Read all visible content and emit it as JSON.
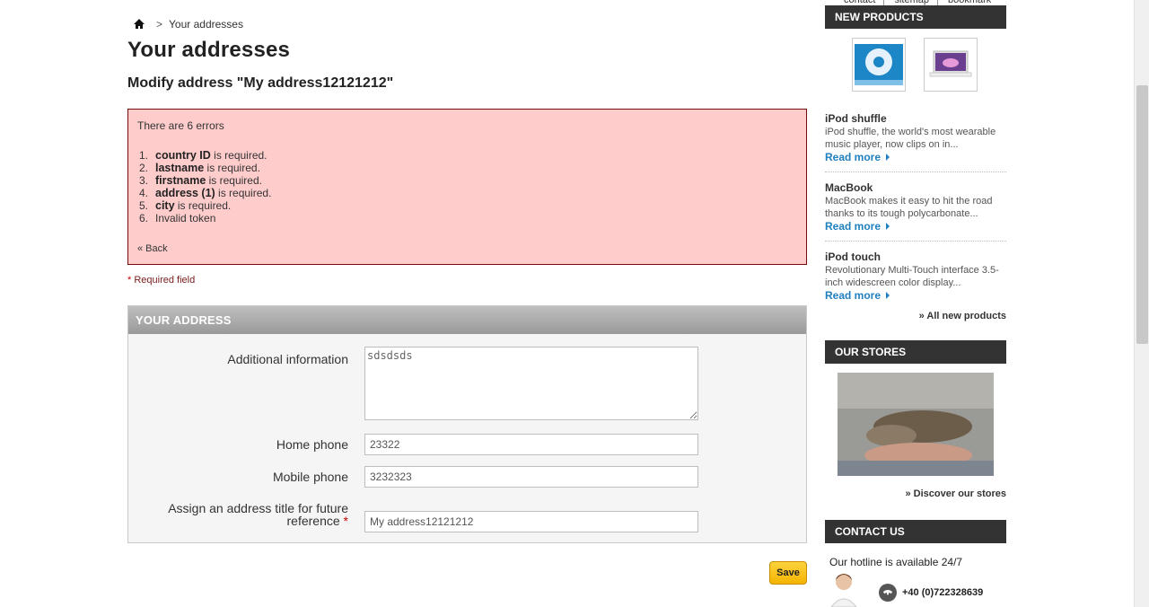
{
  "breadcrumb": {
    "home_icon": "home-icon",
    "separator": ">",
    "current": "Your addresses"
  },
  "page": {
    "title": "Your addresses",
    "subtitle": "Modify address \"My address12121212\""
  },
  "errors": {
    "title": "There are 6 errors",
    "items": [
      {
        "num": "1.",
        "field": "country ID",
        "msg": " is required."
      },
      {
        "num": "2.",
        "field": "lastname",
        "msg": " is required."
      },
      {
        "num": "3.",
        "field": "firstname",
        "msg": " is required."
      },
      {
        "num": "4.",
        "field": "address (1)",
        "msg": " is required."
      },
      {
        "num": "5.",
        "field": "city",
        "msg": " is required."
      },
      {
        "num": "6.",
        "field": "",
        "msg": "Invalid token"
      }
    ],
    "back_link": "« Back"
  },
  "required_note": {
    "star": "*",
    "text": " Required field"
  },
  "address_form": {
    "header": "YOUR ADDRESS",
    "additional_info": {
      "label": "Additional information",
      "value": "sdsdsds"
    },
    "home_phone": {
      "label": "Home phone",
      "value": "23322"
    },
    "mobile_phone": {
      "label": "Mobile phone",
      "value": "3232323"
    },
    "alias": {
      "label": "Assign an address title for future reference",
      "star": "*",
      "value": "My address12121212"
    },
    "save_label": "Save"
  },
  "top_links": [
    "contact",
    "sitemap",
    "bookmark"
  ],
  "new_products": {
    "header": "NEW PRODUCTS",
    "items": [
      {
        "name": "iPod shuffle",
        "desc": "iPod shuffle, the world's most wearable music player, now clips on in...",
        "read_more": "Read more"
      },
      {
        "name": "MacBook",
        "desc": "MacBook makes it easy to hit the road thanks to its tough polycarbonate...",
        "read_more": "Read more"
      },
      {
        "name": "iPod touch",
        "desc": "Revolutionary Multi-Touch interface 3.5-inch widescreen color display...",
        "read_more": "Read more"
      }
    ],
    "all_link": "» All new products"
  },
  "stores": {
    "header": "OUR STORES",
    "discover_link": "» Discover our stores"
  },
  "contact": {
    "header": "CONTACT US",
    "hotline": "Our hotline is available 24/7",
    "phone": "+40 (0)722328639"
  },
  "colors": {
    "error_bg": "#ffcccc",
    "error_border": "#7a0a0a",
    "link_blue": "#1f7fbf",
    "save_yellow": "#f4b400",
    "block_head": "#333333"
  }
}
